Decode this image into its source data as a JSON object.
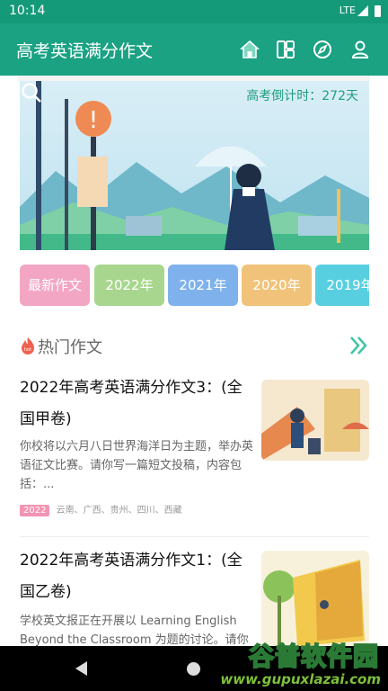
{
  "status_bar": {
    "time": "10:14",
    "network": "LTE"
  },
  "app_bar": {
    "title": "高考英语满分作文",
    "icons": [
      "home-icon",
      "grid-icon",
      "discover-icon",
      "profile-icon"
    ]
  },
  "banner": {
    "countdown": "高考倒计时：272天"
  },
  "chips": [
    {
      "label": "最新作文",
      "color": "#f3a6c4"
    },
    {
      "label": "2022年",
      "color": "#a8d68e"
    },
    {
      "label": "2021年",
      "color": "#7fb2ec"
    },
    {
      "label": "2020年",
      "color": "#f1c37a"
    },
    {
      "label": "2019年",
      "color": "#58cfe0"
    }
  ],
  "section": {
    "title": "热门作文"
  },
  "articles": [
    {
      "title": "2022年高考英语满分作文3：(全国甲卷)",
      "summary": "你校将以六月八日世界海洋日为主题，举办英语征文比赛。请你写一篇短文投稿，内容包括：...",
      "year": "2022",
      "regions": "云南、广西、贵州、四川、西藏"
    },
    {
      "title": "2022年高考英语满分作文1：(全国乙卷)",
      "summary": "学校英文报正在开展以 Learning English Beyond the Classroom 为题的讨论。请你"
    }
  ],
  "watermark": {
    "brand": "谷普软件园",
    "url": "www.gupuxlazai.com"
  },
  "colors": {
    "primary": "#1aa283",
    "status": "#149a79",
    "accent_text": "#1e9e7e"
  }
}
